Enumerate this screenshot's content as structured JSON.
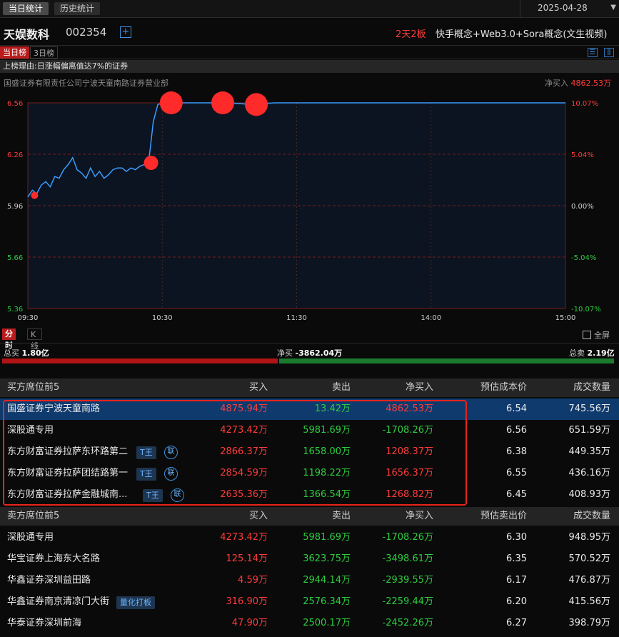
{
  "top_tabs": [
    "当日统计",
    "历史统计"
  ],
  "date": "2025-04-28",
  "stock": {
    "name": "天娱数科",
    "code": "002354",
    "boards": "2天2板",
    "concepts": "快手概念+Web3.0+Sora概念(文生视频)"
  },
  "list_tabs": [
    "当日榜",
    "3日榜"
  ],
  "reason": "上榜理由:日涨幅偏离值达7%的证券",
  "seat_name": "国盛证券有限责任公司宁波天童南路证券营业部",
  "net_buy_label": "净买入",
  "net_buy_value": "4862.53万",
  "chart_tabs": [
    "分时",
    "K线"
  ],
  "fullscreen_label": "全屏",
  "totals": {
    "buy_label": "总买",
    "buy_value": "1.80亿",
    "net_label": "净买",
    "net_value": "-3862.04万",
    "sell_label": "总卖",
    "sell_value": "2.19亿"
  },
  "buy_table": {
    "headers": [
      "买方席位前5",
      "买入",
      "卖出",
      "净买入",
      "预估成本价",
      "成交数量"
    ],
    "rows": [
      {
        "name": "国盛证券宁波天童南路",
        "buy": "4875.94万",
        "sell": "13.42万",
        "net": "4862.53万",
        "price": "6.54",
        "vol": "745.56万",
        "tag": "",
        "lian": ""
      },
      {
        "name": "深股通专用",
        "buy": "4273.42万",
        "sell": "5981.69万",
        "net": "-1708.26万",
        "price": "6.56",
        "vol": "651.59万",
        "tag": "",
        "lian": ""
      },
      {
        "name": "东方财富证券拉萨东环路第二",
        "buy": "2866.37万",
        "sell": "1658.00万",
        "net": "1208.37万",
        "price": "6.38",
        "vol": "449.35万",
        "tag": "T王",
        "lian": "联"
      },
      {
        "name": "东方财富证券拉萨团结路第一",
        "buy": "2854.59万",
        "sell": "1198.22万",
        "net": "1656.37万",
        "price": "6.55",
        "vol": "436.16万",
        "tag": "T王",
        "lian": "联"
      },
      {
        "name": "东方财富证券拉萨金融城南...",
        "buy": "2635.36万",
        "sell": "1366.54万",
        "net": "1268.82万",
        "price": "6.45",
        "vol": "408.93万",
        "tag": "T王",
        "lian": "联"
      }
    ]
  },
  "sell_table": {
    "headers": [
      "卖方席位前5",
      "买入",
      "卖出",
      "净买入",
      "预估卖出价",
      "成交数量"
    ],
    "rows": [
      {
        "name": "深股通专用",
        "buy": "4273.42万",
        "sell": "5981.69万",
        "net": "-1708.26万",
        "price": "6.30",
        "vol": "948.95万",
        "tag": ""
      },
      {
        "name": "华宝证券上海东大名路",
        "buy": "125.14万",
        "sell": "3623.75万",
        "net": "-3498.61万",
        "price": "6.35",
        "vol": "570.52万",
        "tag": ""
      },
      {
        "name": "华鑫证券深圳益田路",
        "buy": "4.59万",
        "sell": "2944.14万",
        "net": "-2939.55万",
        "price": "6.17",
        "vol": "476.87万",
        "tag": ""
      },
      {
        "name": "华鑫证券南京清凉门大街",
        "buy": "316.90万",
        "sell": "2576.34万",
        "net": "-2259.44万",
        "price": "6.20",
        "vol": "415.56万",
        "tag": "量化打板"
      },
      {
        "name": "华泰证券深圳前海",
        "buy": "47.90万",
        "sell": "2500.17万",
        "net": "-2452.26万",
        "price": "6.27",
        "vol": "398.79万",
        "tag": ""
      }
    ]
  },
  "chart_data": {
    "type": "line",
    "y_ticks": [
      "6.56",
      "6.26",
      "5.96",
      "5.66",
      "5.36"
    ],
    "pct_ticks": [
      "10.07%",
      "5.04%",
      "0.00%",
      "-5.04%",
      "-10.07%"
    ],
    "x_ticks": [
      "09:30",
      "10:30",
      "11:30",
      "14:00",
      "15:00"
    ],
    "ylim": [
      5.36,
      6.56
    ],
    "x_minutes_range": [
      0,
      240
    ],
    "colors": {
      "line": "#3d9bff",
      "grid_red": "#7a1c1c",
      "bubble": "#ff2a2a",
      "up": "#ff3b3b",
      "down": "#2ecc40"
    },
    "series": [
      {
        "x": [
          0,
          2,
          4,
          6,
          8,
          10,
          12,
          14,
          16,
          18,
          20,
          22,
          24,
          26,
          28,
          30,
          32,
          34,
          36,
          38,
          40,
          42,
          44,
          46,
          48,
          50,
          52,
          54,
          56,
          58,
          60,
          62,
          64,
          66,
          68,
          70,
          80,
          90,
          100,
          110,
          120,
          130,
          140,
          150,
          160,
          170,
          180,
          190,
          200,
          210,
          220,
          230,
          240
        ],
        "y": [
          6.01,
          6.05,
          6.03,
          6.08,
          6.1,
          6.07,
          6.13,
          6.12,
          6.17,
          6.2,
          6.24,
          6.17,
          6.15,
          6.12,
          6.18,
          6.13,
          6.16,
          6.12,
          6.14,
          6.17,
          6.18,
          6.18,
          6.16,
          6.18,
          6.17,
          6.19,
          6.2,
          6.22,
          6.45,
          6.55,
          6.56,
          6.56,
          6.56,
          6.56,
          6.56,
          6.56,
          6.56,
          6.56,
          6.55,
          6.56,
          6.56,
          6.56,
          6.56,
          6.56,
          6.56,
          6.56,
          6.56,
          6.56,
          6.56,
          6.56,
          6.56,
          6.56,
          6.56
        ]
      }
    ],
    "bubbles": [
      {
        "x": 3,
        "y": 6.02,
        "size": "small"
      },
      {
        "x": 55,
        "y": 6.21,
        "size": "medium"
      },
      {
        "x": 64,
        "y": 6.56,
        "size": "large"
      },
      {
        "x": 87,
        "y": 6.56,
        "size": "large"
      },
      {
        "x": 102,
        "y": 6.55,
        "size": "large"
      }
    ]
  }
}
